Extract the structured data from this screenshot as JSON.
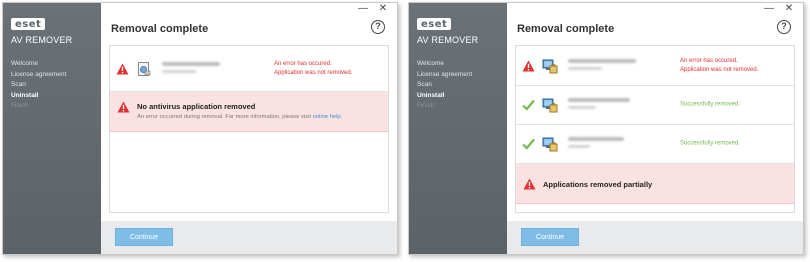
{
  "colors": {
    "error": "#e0302f",
    "success": "#76b84e",
    "sidebar": "#62696e",
    "banner_bg": "#fbe2e2",
    "button": "#7fbde7"
  },
  "left": {
    "logo": {
      "badge": "eset",
      "product": "AV REMOVER"
    },
    "nav": [
      "Welcome",
      "License agreement",
      "Scan",
      "Uninstall",
      "Finish"
    ],
    "controls": {
      "minimize": "—",
      "close": "✕"
    },
    "title": "Removal complete",
    "help": "?",
    "rows": [
      {
        "status_icon": "warning-icon",
        "app_icon": "installer-icon",
        "msg_line1": "An error has occured.",
        "msg_line2": "Application was not removed."
      }
    ],
    "banner": {
      "title": "No antivirus application removed",
      "desc": "An error occurred during removal. For more information, please visit ",
      "link": "online help",
      "desc_end": "."
    },
    "footer": {
      "continue_label": "Continue"
    }
  },
  "right": {
    "logo": {
      "badge": "eset",
      "product": "AV REMOVER"
    },
    "nav": [
      "Welcome",
      "License agreement",
      "Scan",
      "Uninstall",
      "Finish"
    ],
    "controls": {
      "minimize": "—",
      "close": "✕"
    },
    "title": "Removal complete",
    "help": "?",
    "rows": [
      {
        "status_icon": "warning-icon",
        "app_icon": "computer-package-icon",
        "msg_line1": "An error has occured.",
        "msg_line2": "Application was not removed."
      },
      {
        "status_icon": "checkmark-icon",
        "app_icon": "computer-package-icon",
        "msg_line1": "Successfully removed."
      },
      {
        "status_icon": "checkmark-icon",
        "app_icon": "computer-package-icon",
        "msg_line1": "Successfully removed."
      }
    ],
    "banner": {
      "title": "Applications removed partially"
    },
    "footer": {
      "continue_label": "Continue"
    }
  }
}
